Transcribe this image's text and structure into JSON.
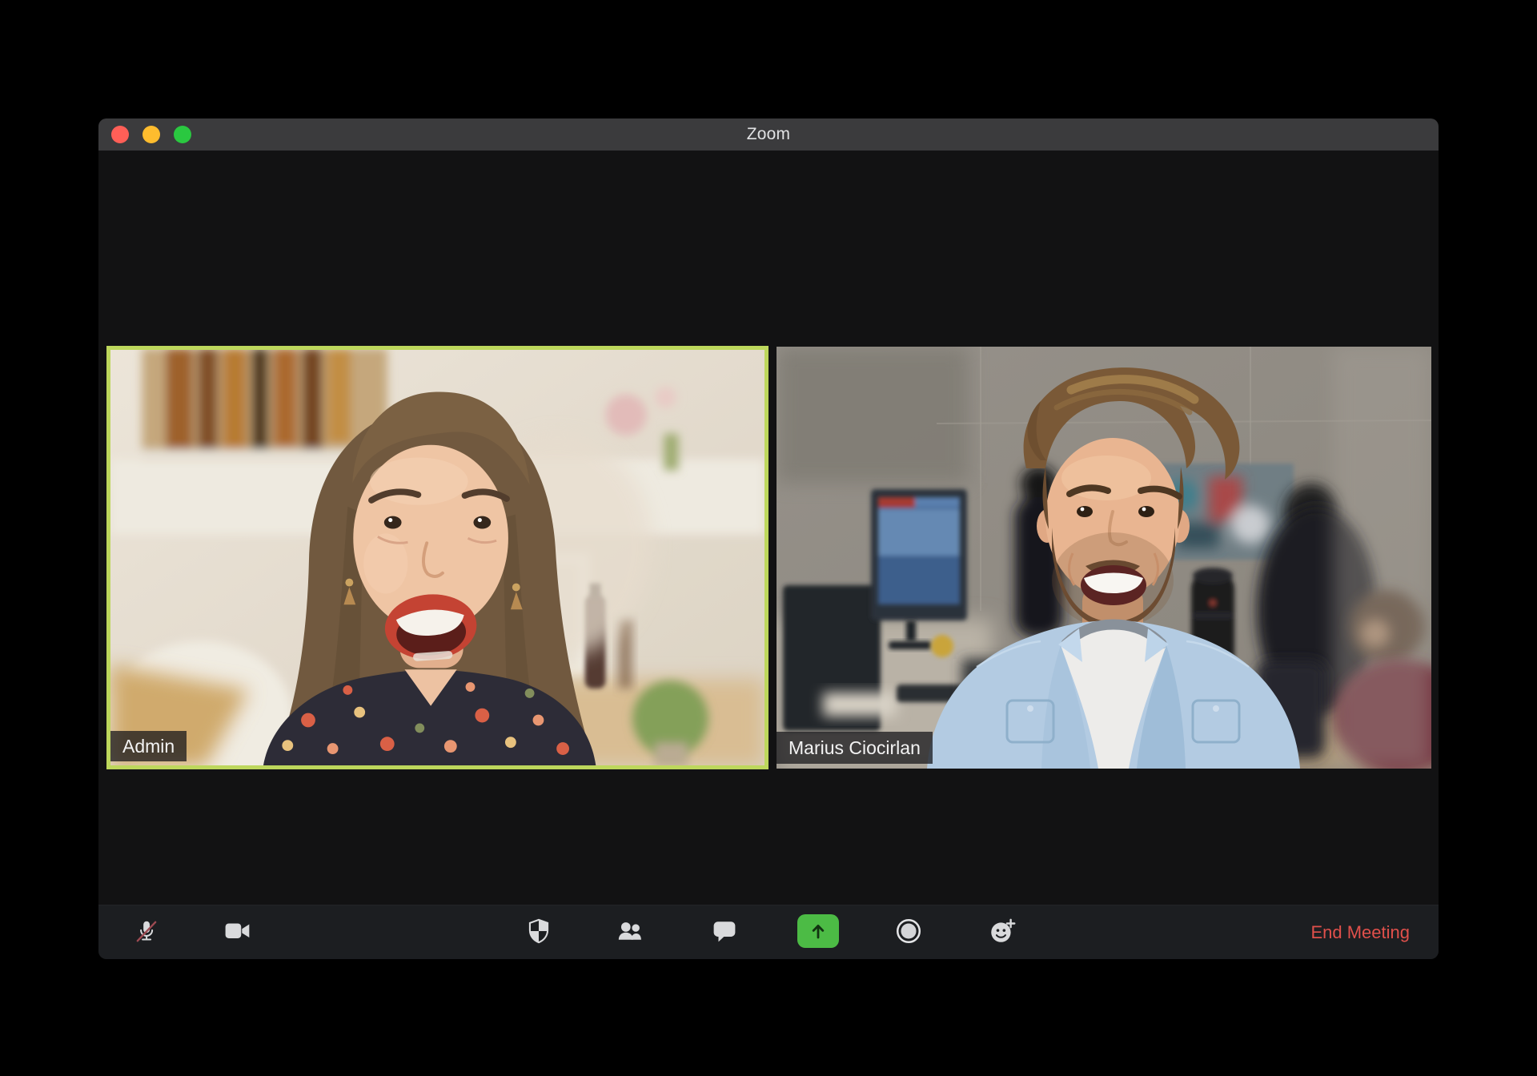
{
  "window": {
    "title": "Zoom",
    "traffic_lights": [
      "close",
      "minimize",
      "fullscreen"
    ]
  },
  "participants": [
    {
      "name": "Admin",
      "active_speaker": true
    },
    {
      "name": "Marius Ciocirlan",
      "active_speaker": false
    }
  ],
  "toolbar": {
    "buttons": [
      {
        "id": "mute",
        "icon": "microphone-muted-icon",
        "state": "muted"
      },
      {
        "id": "video",
        "icon": "video-camera-icon"
      },
      {
        "id": "security",
        "icon": "security-shield-icon"
      },
      {
        "id": "participants",
        "icon": "participants-icon"
      },
      {
        "id": "chat",
        "icon": "chat-bubble-icon"
      },
      {
        "id": "share-screen",
        "icon": "share-screen-up-arrow-icon"
      },
      {
        "id": "record",
        "icon": "record-circle-icon"
      },
      {
        "id": "reactions",
        "icon": "smiley-plus-icon"
      }
    ],
    "end_meeting_label": "End Meeting"
  },
  "colors": {
    "active_speaker_border": "#bdd75c",
    "share_button_green": "#4cbb45",
    "end_meeting_red": "#e0504b",
    "titlebar_bg": "#3b3b3d",
    "toolbar_bg": "#1c1e21",
    "window_bg": "#121213",
    "icon_color": "#d9dadc",
    "name_label_bg": "rgba(22,22,25,0.74)",
    "traffic_red": "#ff5f57",
    "traffic_yellow": "#febc2e",
    "traffic_green": "#2ac840"
  }
}
